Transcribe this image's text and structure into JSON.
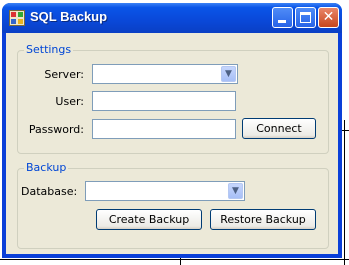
{
  "window": {
    "title": "SQL Backup",
    "title_icon": "database-app-icon",
    "controls": {
      "minimize": "_",
      "maximize": "□",
      "close": "✕"
    }
  },
  "settings": {
    "group_title": "Settings",
    "server_label": "Server:",
    "server_value": "",
    "user_label": "User:",
    "user_value": "",
    "password_label": "Password:",
    "password_value": "",
    "connect_label": "Connect"
  },
  "backup": {
    "group_title": "Backup",
    "database_label": "Database:",
    "database_value": "",
    "create_label": "Create Backup",
    "restore_label": "Restore Backup"
  },
  "colors": {
    "titlebar": "#0a48d8",
    "client": "#ece9d8",
    "group_title": "#0046d5",
    "close_button": "#c8461d"
  }
}
